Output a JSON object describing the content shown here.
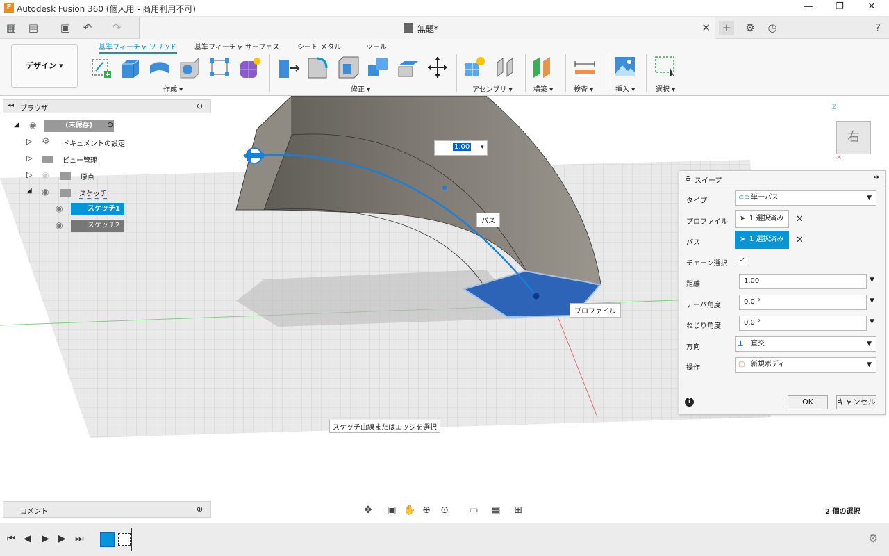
{
  "window": {
    "title": "Autodesk Fusion 360 (個人用 - 商用利用不可)",
    "min": "—",
    "max": "❐",
    "close": "✕"
  },
  "tabbar": {
    "doc_name": "無題*",
    "close": "✕",
    "add": "+"
  },
  "ribbon": {
    "design_label": "デザイン ▾",
    "tabs": [
      "基準フィーチャ ソリッド",
      "基準フィーチャ サーフェス",
      "シート メタル",
      "ツール"
    ],
    "groups": [
      "作成 ▾",
      "修正 ▾",
      "アセンブリ ▾",
      "構築 ▾",
      "検査 ▾",
      "挿入 ▾",
      "選択 ▾"
    ]
  },
  "browser": {
    "title": "ブラウザ",
    "root": "(未保存)",
    "items": [
      "ドキュメントの設定",
      "ビュー管理",
      "原点",
      "スケッチ"
    ],
    "sketches": [
      "スケッチ1",
      "スケッチ2"
    ]
  },
  "viewport": {
    "distance_input": "1.00",
    "path_label": "パス",
    "profile_label": "プロファイル",
    "hint": "スケッチ曲線またはエッジを選択",
    "viewcube_face": "右",
    "axis_z": "Z",
    "axis_x": "X"
  },
  "sweep": {
    "title": "スイープ",
    "type_label": "タイプ",
    "type_value": "単一パス",
    "profile_label": "プロファイル",
    "profile_value": "1 選択済み",
    "path_label": "パス",
    "path_value": "1 選択済み",
    "chain_label": "チェーン選択",
    "chain_checked": "✓",
    "distance_label": "距離",
    "distance_value": "1.00",
    "taper_label": "テーパ角度",
    "taper_value": "0.0 °",
    "twist_label": "ねじり角度",
    "twist_value": "0.0 °",
    "orient_label": "方向",
    "orient_value": "直交",
    "op_label": "操作",
    "op_value": "新規ボディ",
    "ok": "OK",
    "cancel": "キャンセル",
    "info_icon": "i"
  },
  "comments": {
    "title": "コメント"
  },
  "status": {
    "selection": "2 個の選択"
  },
  "colors": {
    "accent": "#0696d7",
    "profile_fill": "#2e64b8",
    "body": "#7a7670"
  }
}
